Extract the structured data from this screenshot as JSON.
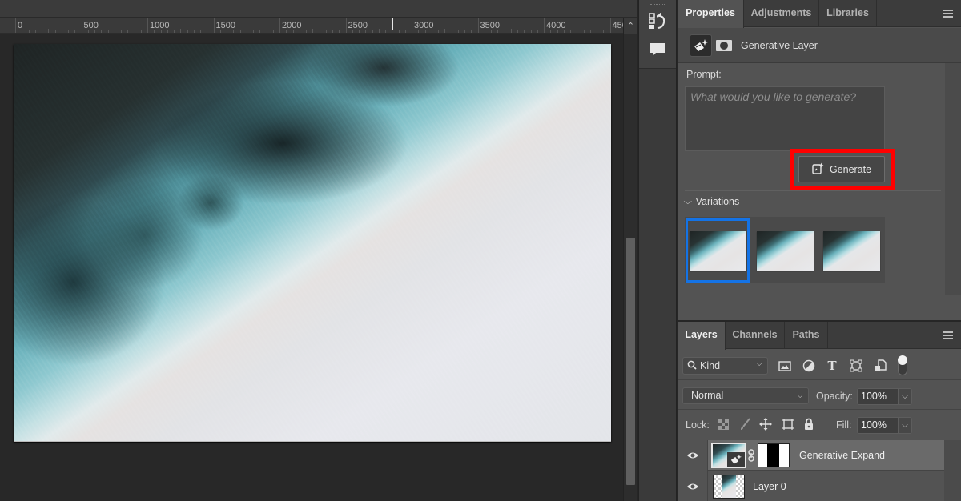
{
  "canvas": {
    "ruler": {
      "labels": [
        "0",
        "500",
        "1000",
        "1500",
        "2000",
        "2500",
        "3000",
        "3500",
        "4000",
        "450"
      ]
    },
    "scroll_up_label": "^"
  },
  "properties_panel": {
    "tabs": [
      {
        "label": "Properties",
        "active": true
      },
      {
        "label": "Adjustments",
        "active": false
      },
      {
        "label": "Libraries",
        "active": false
      }
    ],
    "layer_type": "Generative Layer",
    "prompt_label": "Prompt:",
    "prompt_value": "",
    "prompt_placeholder": "What would you like to generate?",
    "generate_label": "Generate",
    "highlight_color": "#ff0000",
    "variations_label": "Variations",
    "variations": [
      {
        "name": "variation-1",
        "selected": true
      },
      {
        "name": "variation-2",
        "selected": false
      },
      {
        "name": "variation-3",
        "selected": false
      }
    ],
    "selection_color": "#1473e6"
  },
  "layers_panel": {
    "tabs": [
      {
        "label": "Layers",
        "active": true
      },
      {
        "label": "Channels",
        "active": false
      },
      {
        "label": "Paths",
        "active": false
      }
    ],
    "filter_kind": "Kind",
    "blend_mode": "Normal",
    "opacity_label": "Opacity:",
    "opacity_value": "100%",
    "lock_label": "Lock:",
    "fill_label": "Fill:",
    "fill_value": "100%",
    "layers": [
      {
        "name": "Generative Expand",
        "visible": true,
        "selected": true
      },
      {
        "name": "Layer 0",
        "visible": true,
        "selected": false
      }
    ]
  }
}
